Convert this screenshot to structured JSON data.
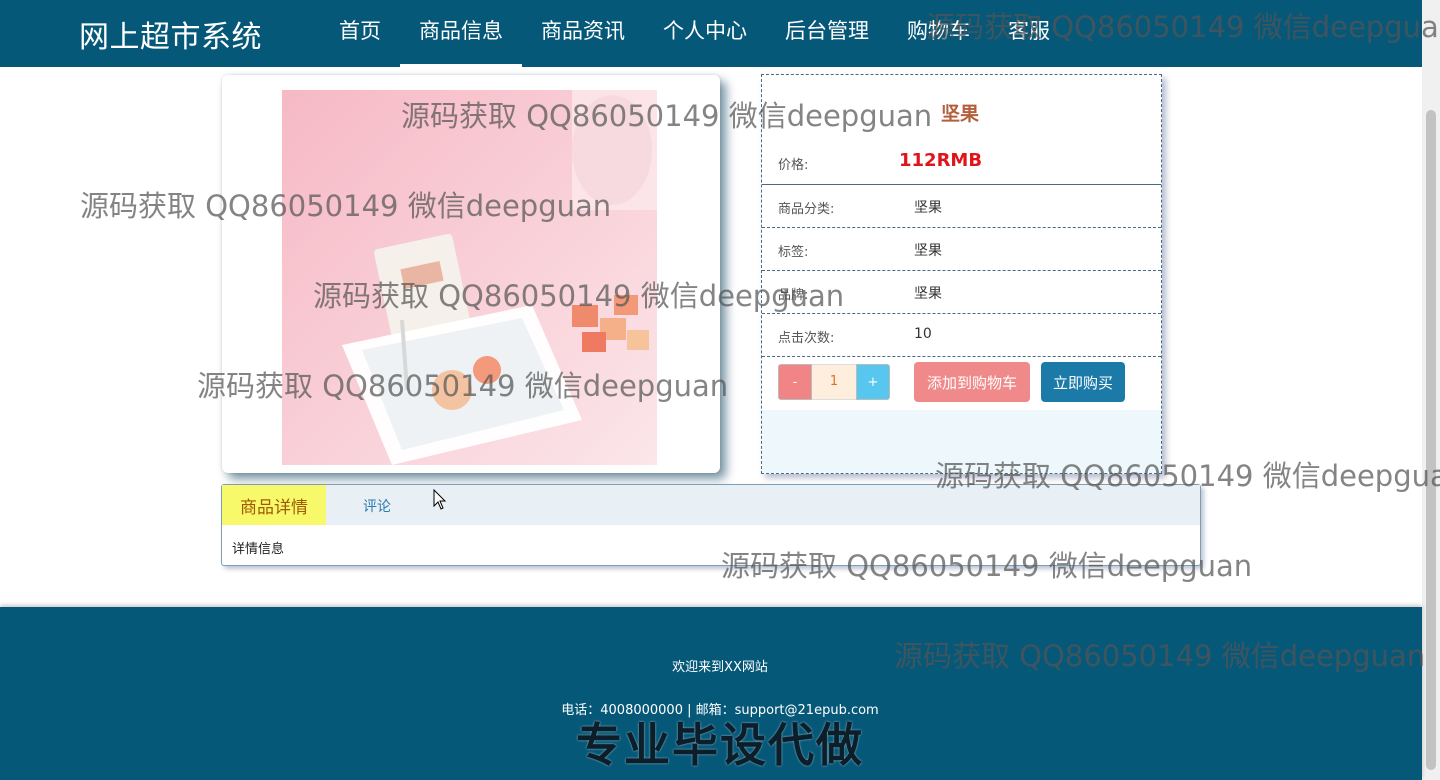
{
  "header": {
    "logo": "网上超市系统",
    "nav": [
      {
        "label": "首页"
      },
      {
        "label": "商品信息"
      },
      {
        "label": "商品资讯"
      },
      {
        "label": "个人中心"
      },
      {
        "label": "后台管理"
      },
      {
        "label": "购物车"
      },
      {
        "label": "客服"
      }
    ],
    "active_nav": "商品信息"
  },
  "product": {
    "name": "坚果",
    "price_label": "价格:",
    "price": "112RMB",
    "fields": [
      {
        "label": "商品分类:",
        "value": "坚果"
      },
      {
        "label": "标签:",
        "value": "坚果"
      },
      {
        "label": "品牌:",
        "value": "坚果"
      },
      {
        "label": "点击次数:",
        "value": "10"
      }
    ],
    "quantity": {
      "minus": "-",
      "value": "1",
      "plus": "+"
    },
    "add_to_cart": "添加到购物车",
    "buy_now": "立即购买"
  },
  "tabs": {
    "detail": "商品详情",
    "comment": "评论",
    "detail_content": "详情信息"
  },
  "footer": {
    "welcome": "欢迎来到XX网站",
    "contact": "电话：4008000000 | 邮箱：support@21epub.com",
    "promo": "专业毕设代做"
  },
  "watermark": "源码获取 QQ86050149 微信deepguan",
  "colors": {
    "header_bg": "#065879",
    "price": "#e0141b",
    "cart_button": "#f08a8a",
    "buy_button": "#1b7aa8",
    "tab_active": "#f7f86a"
  }
}
